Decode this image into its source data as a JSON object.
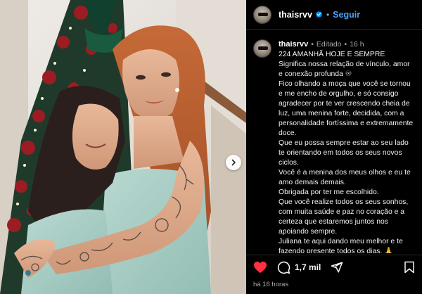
{
  "header": {
    "username": "thaisrvv",
    "separator": "•",
    "follow_label": "Seguir",
    "verified_icon": "verified-badge-icon"
  },
  "caption": {
    "username": "thaisrvv",
    "edited_label": "Editado",
    "separator": "•",
    "time": "16 h",
    "lines": [
      "224 AMANHÃ HOJE E SEMPRE",
      "Significa nossa relação de vínculo, amor e conexão profunda ♾",
      "Fico olhando a moça que você se tornou e me encho de orgulho, e só consigo agradecer por te ver crescendo cheia de luz, uma menina forte, decidida, com a personalidade fortíssima e extremamente doce.",
      "Que eu possa sempre estar ao seu lado te orientando em todos os seus novos ciclos.",
      "Você é a menina dos meus olhos e eu te amo demais demais.",
      "Obrigada por ter me escolhido.",
      "Que você realize todos os seus sonhos, com muita saúde e paz no coração e a certeza que estaremos juntos nos apoiando sempre.",
      "Juliana te aqui dando meu melhor e te fazendo presente todos os dias. 🙏"
    ]
  },
  "actions": {
    "like_icon": "heart-icon",
    "comment_icon": "comment-icon",
    "comment_count": "1,7 mil",
    "share_icon": "share-icon",
    "save_icon": "bookmark-icon",
    "liked_color": "#ff3040",
    "time_ago": "há 16 horas"
  },
  "photo": {
    "next_icon": "chevron-right-icon"
  },
  "colors": {
    "background": "#000000",
    "link_blue": "#4aa1f7",
    "muted_text": "#a8a8a8",
    "divider": "#262626"
  }
}
